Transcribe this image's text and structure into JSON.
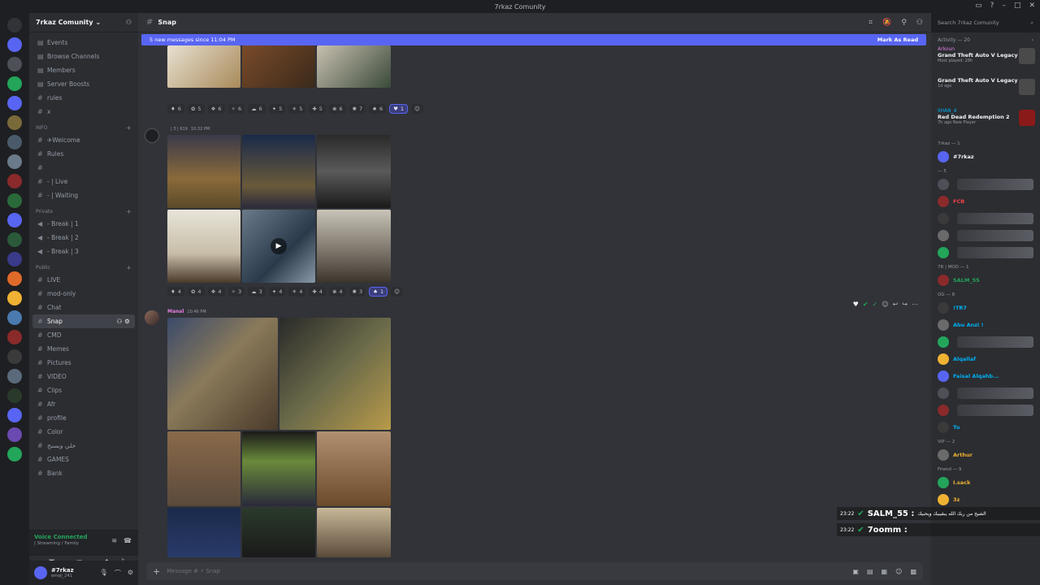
{
  "window": {
    "title": "7rkaz Comunity"
  },
  "guild": {
    "name": "7rkaz Comunity"
  },
  "nav": [
    "Events",
    "Browse Channels",
    "Members",
    "Server Boosts"
  ],
  "top_channels": [
    "rules",
    "x"
  ],
  "categories": [
    {
      "name": "INFO",
      "channels": [
        "✈Welcome",
        "Rules",
        "",
        "- | Live",
        "- | Waiting"
      ]
    },
    {
      "name": "Private",
      "channels": [
        "- Break | 1",
        "- Break | 2",
        "- Break | 3"
      ]
    },
    {
      "name": "Public",
      "channels": [
        "LIVE",
        "mod-only",
        "Chat",
        "Snap",
        "CMD",
        "Memes",
        "Pictures",
        "VIDEO",
        "Clips",
        "Afr",
        "profile",
        "Color",
        "خلي ويسنج",
        "GAMES",
        "Bank"
      ]
    }
  ],
  "voice": {
    "status": "Voice Connected",
    "sub": "| Streaming / Family"
  },
  "user": {
    "name": "#7rkaz",
    "status": "emoji_241"
  },
  "channel": {
    "name": "Snap"
  },
  "new_messages": {
    "text": "5 new messages since 11:04 PM",
    "action": "Mark As Read"
  },
  "messages": [
    {
      "reactions": [
        "6",
        "5",
        "6",
        "6",
        "6",
        "5",
        "5",
        "5",
        "6",
        "7",
        "6",
        "1"
      ]
    },
    {
      "author": "",
      "tag": "| 3 | 619",
      "time": "10:32 PM",
      "reactions": [
        "4",
        "4",
        "4",
        "3",
        "3",
        "4",
        "4",
        "4",
        "4",
        "3",
        "1"
      ]
    },
    {
      "author": "Manal",
      "time": "10:46 PM"
    }
  ],
  "composer": {
    "placeholder": "Message # ⚡ Snap"
  },
  "search": {
    "placeholder": "Search 7rkaz Comunity"
  },
  "activity": {
    "title": "Activity — 20",
    "items": [
      {
        "name": "Arkoun",
        "game": "Grand Theft Auto V Legacy",
        "sub": "Most played: 28h"
      },
      {
        "name": "",
        "game": "Grand Theft Auto V Legacy",
        "sub": "1d ago"
      },
      {
        "name": "IIHAN_4",
        "game": "Red Dead Redemption 2",
        "sub": "7h ago  New Player"
      }
    ]
  },
  "member_sections": [
    {
      "title": "7rkaz — 1",
      "members": [
        {
          "name": "#7rkaz",
          "color": "#f2f3f5"
        }
      ]
    },
    {
      "title": "— 5",
      "members": [
        {
          "name": "",
          "color": "#f23f43"
        },
        {
          "name": "FCB",
          "color": "#f23f43"
        },
        {
          "name": "",
          "color": "#f23f43"
        },
        {
          "name": "",
          "color": "#f23f43"
        },
        {
          "name": "",
          "color": "#f23f43"
        }
      ]
    },
    {
      "title": "7R | MOD — 1",
      "members": [
        {
          "name": "SALM_55",
          "color": "#23a55a"
        }
      ]
    },
    {
      "title": "OG — 8",
      "members": [
        {
          "name": "!TR7",
          "color": "#00b0f4"
        },
        {
          "name": "Abu Anzi !",
          "color": "#00b0f4"
        },
        {
          "name": "",
          "color": "#00b0f4"
        },
        {
          "name": "Alqallaf",
          "color": "#00b0f4"
        },
        {
          "name": "Faisal Alqahb...",
          "color": "#00b0f4"
        },
        {
          "name": "",
          "color": "#00b0f4"
        },
        {
          "name": "",
          "color": "#00b0f4"
        },
        {
          "name": "Tu",
          "color": "#00b0f4"
        }
      ]
    },
    {
      "title": "VIP — 2",
      "members": [
        {
          "name": "Arthur",
          "color": "#f0b232"
        }
      ]
    },
    {
      "title": "Friend — 9",
      "members": [
        {
          "name": "I.sack",
          "color": "#f0b232"
        },
        {
          "name": "3z",
          "color": "#f0b232"
        }
      ]
    }
  ],
  "stream_overlay": [
    {
      "time": "23:22",
      "user": "SALM_55 :",
      "text": "الشيخ من ربك الله يبقيبيك ويحبيك"
    },
    {
      "time": "23:22",
      "user": "7oomm :",
      "text": ""
    }
  ],
  "colors": {
    "accent": "#5865f2",
    "online": "#23a55a",
    "danger": "#f23f43"
  }
}
